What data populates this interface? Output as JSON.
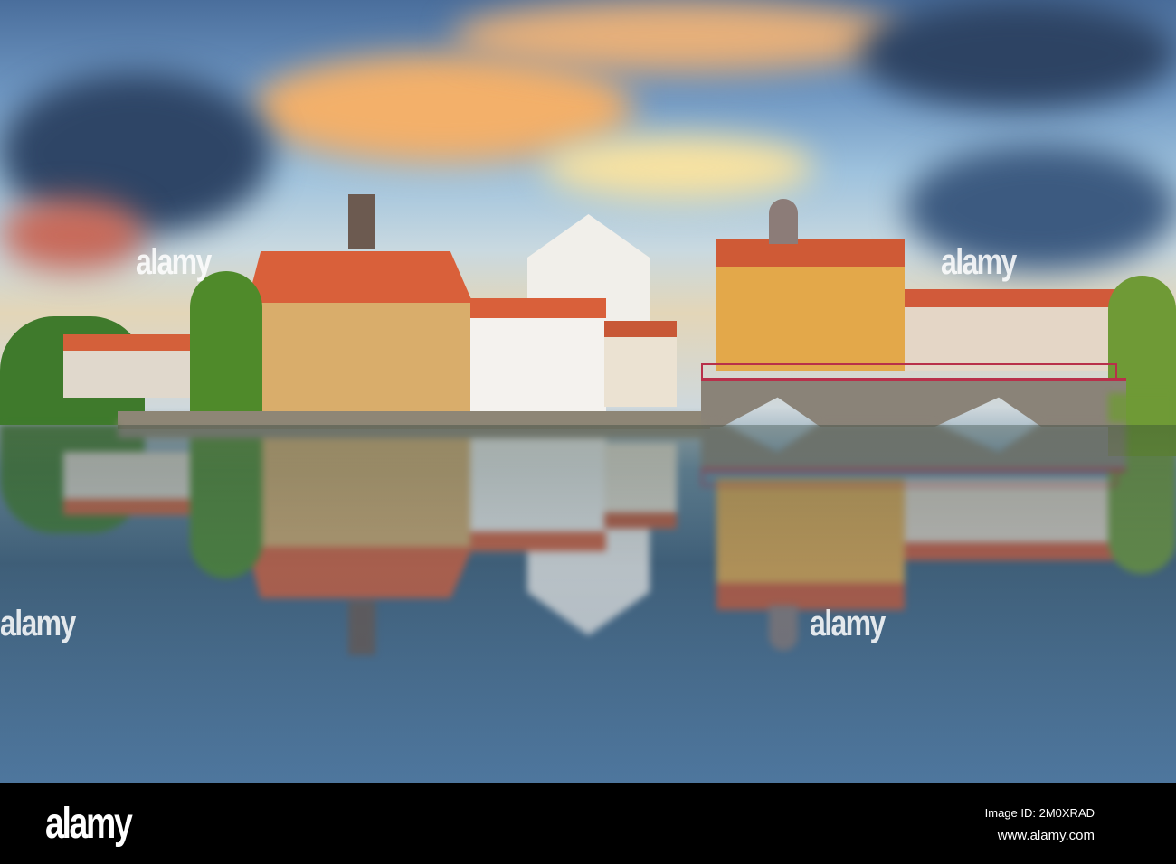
{
  "watermark": {
    "text": "alamy"
  },
  "footer": {
    "logo": "alamy",
    "image_id": "Image ID: 2M0XRAD",
    "url": "www.alamy.com"
  },
  "colors": {
    "sky": "#6f97c2",
    "cloud_glow": "#f2b35a",
    "roof": "#d9603a",
    "facade_yellow": "#e3a84a",
    "bridge_rail": "#b8304a"
  }
}
